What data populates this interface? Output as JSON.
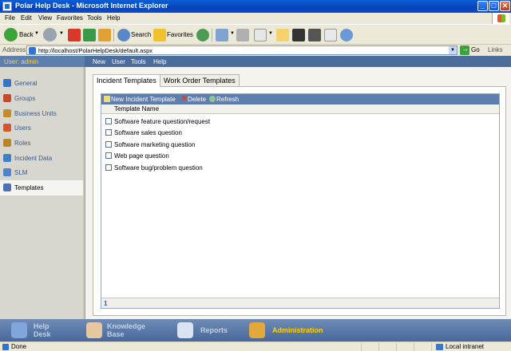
{
  "window": {
    "title": "Polar Help Desk - Microsoft Internet Explorer",
    "minimize": "_",
    "maximize": "□",
    "close": "✕"
  },
  "browser_menu": [
    "File",
    "Edit",
    "View",
    "Favorites",
    "Tools",
    "Help"
  ],
  "toolbar": {
    "back": "Back",
    "search": "Search",
    "favorites": "Favorites"
  },
  "address": {
    "label": "Address",
    "url": "http://localhost/PolarHelpDesk/default.aspx",
    "go": "Go",
    "links": "Links"
  },
  "app": {
    "user_label": "User: admin",
    "menu": [
      "New",
      "User",
      "Tools",
      "Help"
    ]
  },
  "sidebar": {
    "items": [
      {
        "label": "General",
        "icon": "general-icon",
        "color": "#3b73c4"
      },
      {
        "label": "Groups",
        "icon": "groups-icon",
        "color": "#c44a2b"
      },
      {
        "label": "Business Units",
        "icon": "business-units-icon",
        "color": "#c48a2b"
      },
      {
        "label": "Users",
        "icon": "users-icon",
        "color": "#d2562e"
      },
      {
        "label": "Roles",
        "icon": "roles-icon",
        "color": "#b8862a"
      },
      {
        "label": "Incident Data",
        "icon": "incident-data-icon",
        "color": "#3f7fc9"
      },
      {
        "label": "SLM",
        "icon": "slm-icon",
        "color": "#4d86c8"
      },
      {
        "label": "Templates",
        "icon": "templates-icon",
        "color": "#4f73b0"
      }
    ],
    "active_index": 7
  },
  "tabs": [
    "Incident Templates",
    "Work Order Templates"
  ],
  "grid": {
    "actions": {
      "new": "New Incident Template",
      "delete": "Delete",
      "refresh": "Refresh"
    },
    "column_header": "Template Name",
    "rows": [
      "Software feature question/request",
      "Software sales question",
      "Software marketing question",
      "Web page question",
      "Software bug/problem question"
    ],
    "page": "1"
  },
  "modules": [
    {
      "label_line1": "Help",
      "label_line2": "Desk",
      "icon": "help-desk-icon",
      "color": "#7fa7dd"
    },
    {
      "label_line1": "Knowledge",
      "label_line2": "Base",
      "icon": "knowledge-base-icon",
      "color": "#e6c7a0"
    },
    {
      "label_line1": "Reports",
      "label_line2": "",
      "icon": "reports-icon",
      "color": "#d9e3f0"
    },
    {
      "label_line1": "Administration",
      "label_line2": "",
      "icon": "administration-icon",
      "color": "#e3a83a"
    }
  ],
  "status": {
    "text": "Done",
    "zone": "Local intranet"
  }
}
